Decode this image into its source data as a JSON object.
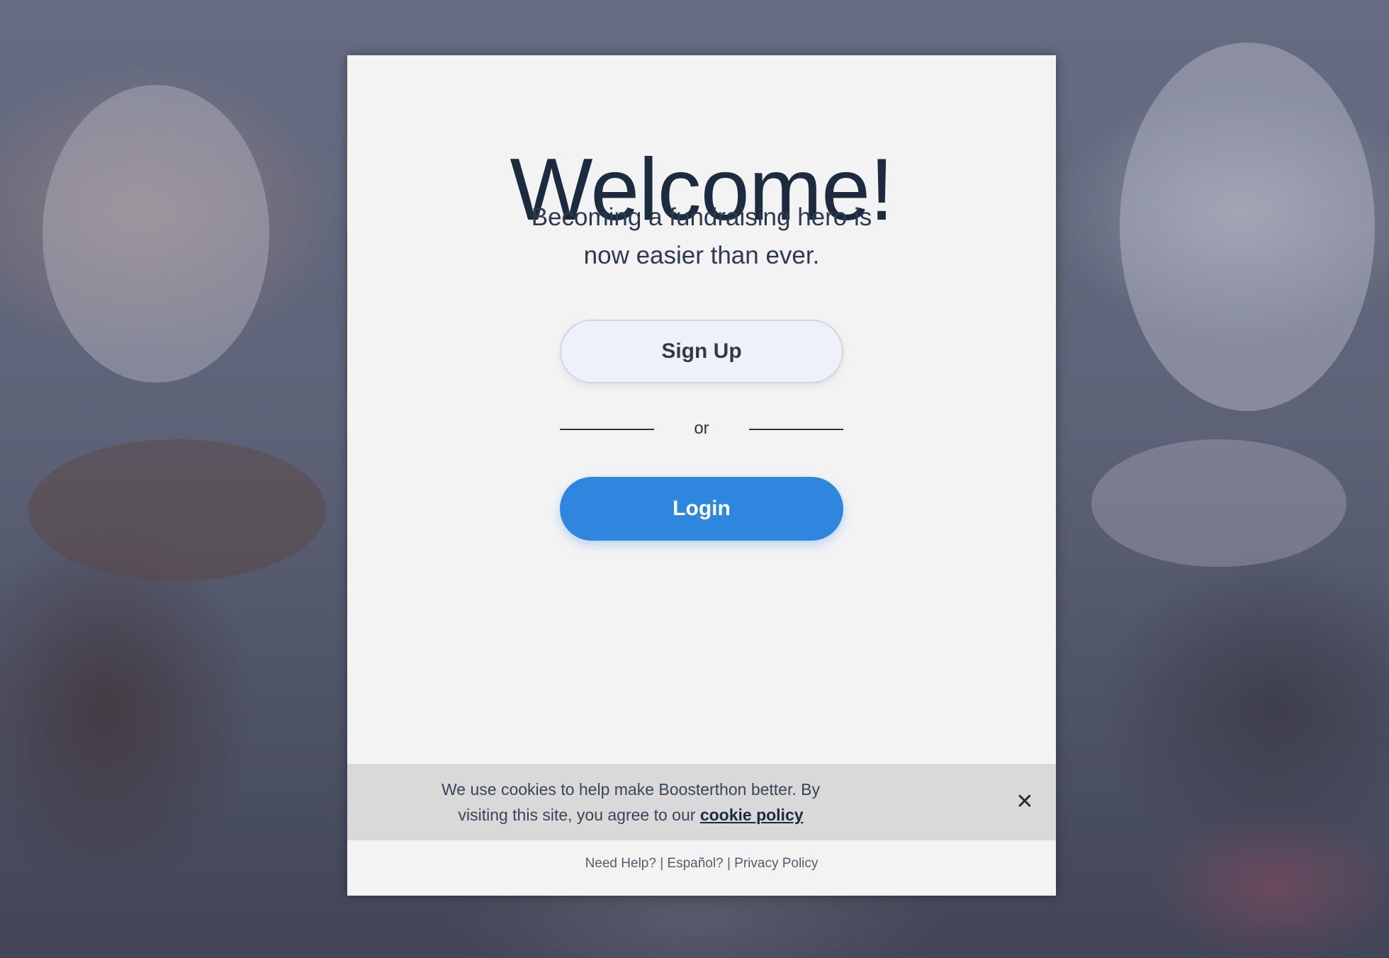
{
  "welcome": {
    "title": "Welcome!",
    "subtitle": "Becoming a fundraising hero is now easier than ever."
  },
  "actions": {
    "signup_label": "Sign Up",
    "or_label": "or",
    "login_label": "Login"
  },
  "cookie_banner": {
    "text": "We use cookies to help make Boosterthon better. By visiting this site, you agree to our",
    "link_label": "cookie policy",
    "close_icon": "close-icon"
  },
  "footer": {
    "help_link": "Need Help?",
    "separator": "|",
    "spanish_link": "Español?",
    "privacy_link": "Privacy Policy"
  },
  "colors": {
    "primary": "#2f86df",
    "text_dark": "#1d2b3f",
    "card_bg": "#f3f3f3",
    "cookie_bg": "#d9d9d9"
  }
}
